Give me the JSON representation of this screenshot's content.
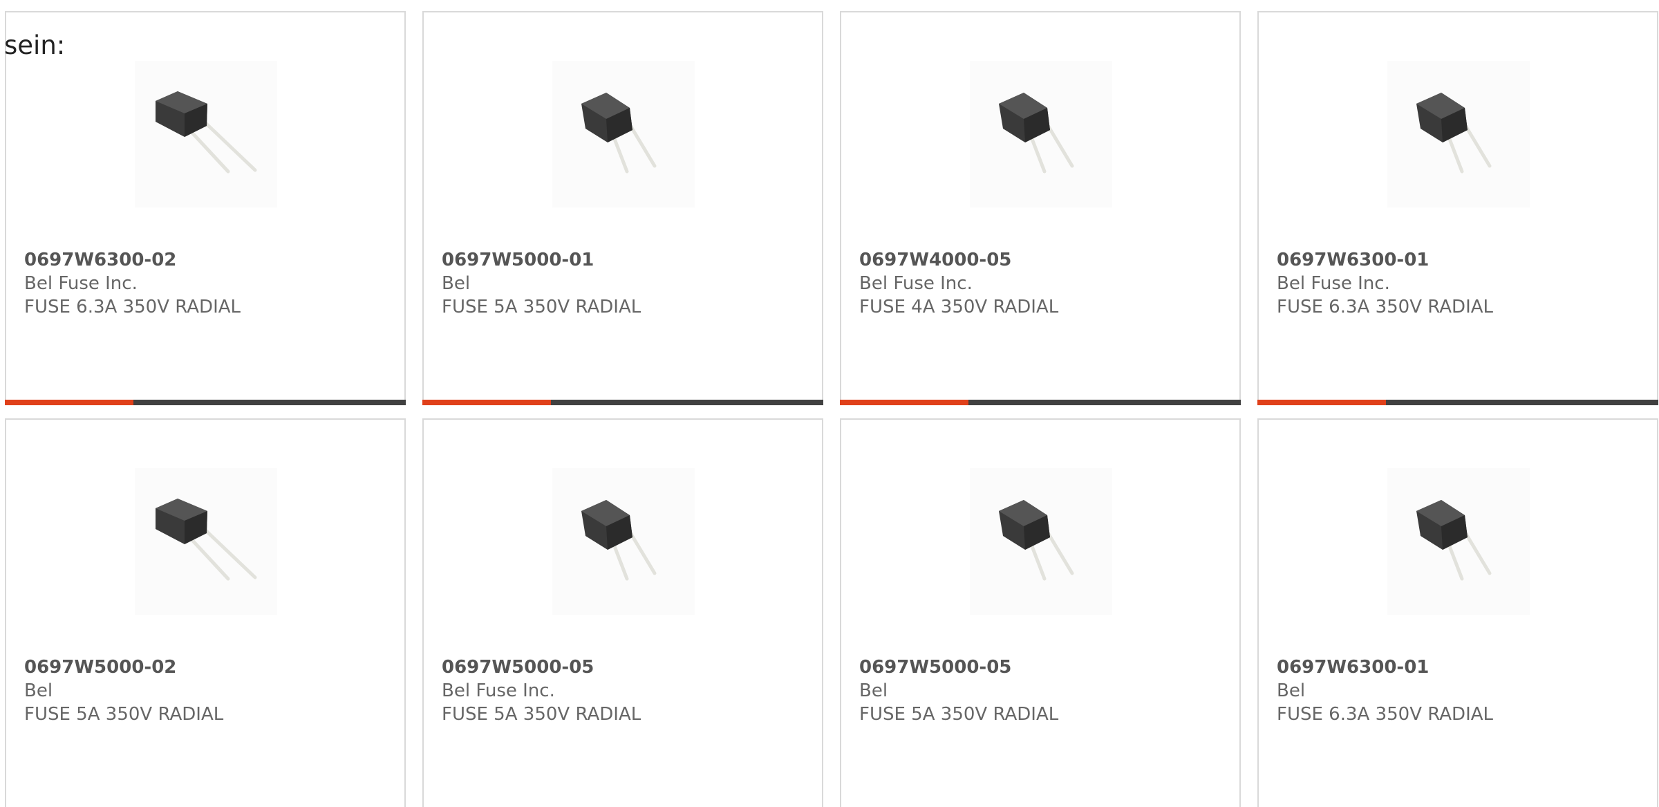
{
  "intro_text": "sein:",
  "colors": {
    "accent": "#e0401a",
    "track": "#404040",
    "border": "#d9d9d9",
    "text": "#666666"
  },
  "products": [
    {
      "part_number": "0697W6300-02",
      "manufacturer": "Bel Fuse Inc.",
      "description": "FUSE 6.3A 350V RADIAL",
      "image_icon": "radial-fuse-icon",
      "progress": 0.32
    },
    {
      "part_number": "0697W5000-01",
      "manufacturer": "Bel",
      "description": "FUSE 5A 350V RADIAL",
      "image_icon": "radial-fuse-icon",
      "progress": 0.32
    },
    {
      "part_number": "0697W4000-05",
      "manufacturer": "Bel Fuse Inc.",
      "description": "FUSE 4A 350V RADIAL",
      "image_icon": "radial-fuse-icon",
      "progress": 0.32
    },
    {
      "part_number": "0697W6300-01",
      "manufacturer": "Bel Fuse Inc.",
      "description": "FUSE 6.3A 350V RADIAL",
      "image_icon": "radial-fuse-icon",
      "progress": 0.32
    },
    {
      "part_number": "0697W5000-02",
      "manufacturer": "Bel",
      "description": "FUSE 5A 350V RADIAL",
      "image_icon": "radial-fuse-icon"
    },
    {
      "part_number": "0697W5000-05",
      "manufacturer": "Bel Fuse Inc.",
      "description": "FUSE 5A 350V RADIAL",
      "image_icon": "radial-fuse-icon"
    },
    {
      "part_number": "0697W5000-05",
      "manufacturer": "Bel",
      "description": "FUSE 5A 350V RADIAL",
      "image_icon": "radial-fuse-icon"
    },
    {
      "part_number": "0697W6300-01",
      "manufacturer": "Bel",
      "description": "FUSE 6.3A 350V RADIAL",
      "image_icon": "radial-fuse-icon"
    }
  ]
}
